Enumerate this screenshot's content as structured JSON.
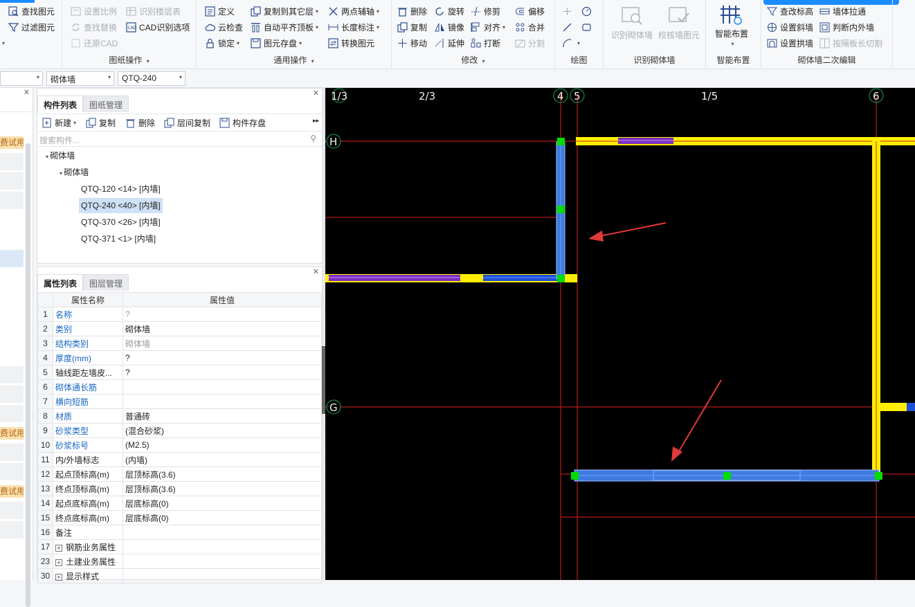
{
  "ribbon": {
    "group1": {
      "items": [
        "查找图元",
        "过滤图元"
      ]
    },
    "group2": {
      "title": "图纸操作",
      "items": [
        "设置比例",
        "识别楼层表",
        "查找替换",
        "CAD识别选项",
        "还原CAD"
      ]
    },
    "group3": {
      "title": "通用操作",
      "items": [
        "定义",
        "复制到其它层",
        "两点辅轴",
        "云检查",
        "自动平齐顶板",
        "长度标注",
        "锁定",
        "图元存盘",
        "转换图元"
      ]
    },
    "group4": {
      "title": "修改",
      "items": [
        "删除",
        "旋转",
        "修剪",
        "偏移",
        "复制",
        "镜像",
        "对齐",
        "合并",
        "移动",
        "延伸",
        "打断",
        "分割"
      ]
    },
    "group5": {
      "title": "绘图"
    },
    "group6": {
      "title": "识别砌体墙",
      "items": [
        "识别砌体墙",
        "校核墙图元"
      ]
    },
    "group7": {
      "title": "智能布置",
      "items": [
        "智能布置"
      ]
    },
    "group8": {
      "title": "砌体墙二次编辑",
      "items": [
        "查改标高",
        "墙体拉通",
        "设置斜墙",
        "判断内外墙",
        "设置拱墙",
        "按隔板长切割"
      ]
    }
  },
  "selectors": {
    "type": "砌体墙",
    "component": "QTQ-240"
  },
  "left_badges": [
    "费试用",
    "费试用",
    "费试用"
  ],
  "panel1": {
    "tabs": [
      "构件列表",
      "图纸管理"
    ],
    "toolbar": [
      "新建",
      "复制",
      "删除",
      "层间复制",
      "构件存盘"
    ],
    "search_placeholder": "搜索构件...",
    "tree": {
      "root": "砌体墙",
      "child": "砌体墙",
      "items": [
        "QTQ-120 <14> [内墙]",
        "QTQ-240 <40> [内墙]",
        "QTQ-370 <26> [内墙]",
        "QTQ-371 <1> [内墙]"
      ],
      "selected_index": 1
    }
  },
  "panel2": {
    "tabs": [
      "属性列表",
      "图层管理"
    ],
    "header": [
      "属性名称",
      "属性值"
    ],
    "rows": [
      {
        "n": "1",
        "name": "名称",
        "value": "?",
        "blue": true,
        "gray_value": true
      },
      {
        "n": "2",
        "name": "类别",
        "value": "砌体墙",
        "blue": true
      },
      {
        "n": "3",
        "name": "结构类别",
        "value": "砌体墙",
        "blue": true,
        "gray_value": true
      },
      {
        "n": "4",
        "name": "厚度(mm)",
        "value": "?",
        "blue": true
      },
      {
        "n": "5",
        "name": "轴线距左墙皮...",
        "value": "?"
      },
      {
        "n": "6",
        "name": "砌体通长筋",
        "value": "",
        "blue": true
      },
      {
        "n": "7",
        "name": "横向短筋",
        "value": "",
        "blue": true
      },
      {
        "n": "8",
        "name": "材质",
        "value": "普通砖",
        "blue": true
      },
      {
        "n": "9",
        "name": "砂浆类型",
        "value": "(混合砂浆)",
        "blue": true
      },
      {
        "n": "10",
        "name": "砂浆标号",
        "value": "(M2.5)",
        "blue": true
      },
      {
        "n": "11",
        "name": "内/外墙标志",
        "value": "(内墙)"
      },
      {
        "n": "12",
        "name": "起点顶标高(m)",
        "value": "层顶标高(3.6)"
      },
      {
        "n": "13",
        "name": "终点顶标高(m)",
        "value": "层顶标高(3.6)"
      },
      {
        "n": "14",
        "name": "起点底标高(m)",
        "value": "层底标高(0)"
      },
      {
        "n": "15",
        "name": "终点底标高(m)",
        "value": "层底标高(0)"
      },
      {
        "n": "16",
        "name": "备注",
        "value": ""
      },
      {
        "n": "17",
        "name": "钢筋业务属性",
        "value": "",
        "expand": true
      },
      {
        "n": "23",
        "name": "土建业务属性",
        "value": "",
        "expand": true
      },
      {
        "n": "30",
        "name": "显示样式",
        "value": "",
        "expand": true
      }
    ]
  },
  "canvas": {
    "axes_top": [
      "1/3",
      "2/3",
      "4",
      "5",
      "1/5",
      "6"
    ],
    "axes_left": [
      "H",
      "G"
    ],
    "colors": {
      "axis": "#e02020",
      "wall_yellow": "#ffee00",
      "wall_purple": "#7b2fbf",
      "wall_blue": "#1e4fd8",
      "selected": "#3f7be0",
      "grip": "#00dd00",
      "arrow": "#e03a3a"
    }
  }
}
